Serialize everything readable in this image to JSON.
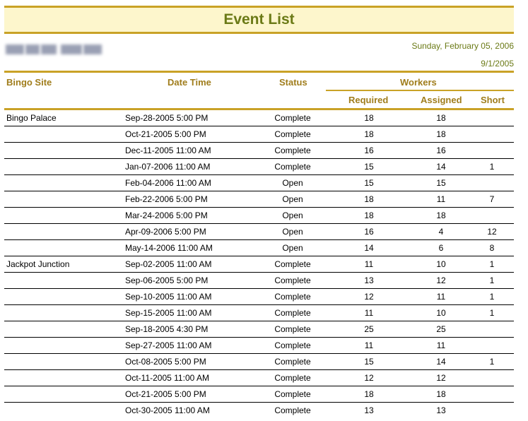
{
  "report": {
    "title": "Event List",
    "date": "Sunday, February 05, 2006",
    "sub_date": "9/1/2005"
  },
  "columns": {
    "site": "Bingo Site",
    "datetime": "Date Time",
    "status": "Status",
    "workers": "Workers",
    "required": "Required",
    "assigned": "Assigned",
    "short": "Short"
  },
  "rows": [
    {
      "site": "Bingo Palace",
      "datetime": "Sep-28-2005 5:00 PM",
      "status": "Complete",
      "required": "18",
      "assigned": "18",
      "short": ""
    },
    {
      "site": "",
      "datetime": "Oct-21-2005 5:00 PM",
      "status": "Complete",
      "required": "18",
      "assigned": "18",
      "short": ""
    },
    {
      "site": "",
      "datetime": "Dec-11-2005 11:00 AM",
      "status": "Complete",
      "required": "16",
      "assigned": "16",
      "short": ""
    },
    {
      "site": "",
      "datetime": "Jan-07-2006 11:00 AM",
      "status": "Complete",
      "required": "15",
      "assigned": "14",
      "short": "1"
    },
    {
      "site": "",
      "datetime": "Feb-04-2006 11:00 AM",
      "status": "Open",
      "required": "15",
      "assigned": "15",
      "short": ""
    },
    {
      "site": "",
      "datetime": "Feb-22-2006 5:00 PM",
      "status": "Open",
      "required": "18",
      "assigned": "11",
      "short": "7"
    },
    {
      "site": "",
      "datetime": "Mar-24-2006 5:00 PM",
      "status": "Open",
      "required": "18",
      "assigned": "18",
      "short": ""
    },
    {
      "site": "",
      "datetime": "Apr-09-2006 5:00 PM",
      "status": "Open",
      "required": "16",
      "assigned": "4",
      "short": "12"
    },
    {
      "site": "",
      "datetime": "May-14-2006 11:00 AM",
      "status": "Open",
      "required": "14",
      "assigned": "6",
      "short": "8"
    },
    {
      "site": "Jackpot Junction",
      "datetime": "Sep-02-2005 11:00 AM",
      "status": "Complete",
      "required": "11",
      "assigned": "10",
      "short": "1"
    },
    {
      "site": "",
      "datetime": "Sep-06-2005 5:00 PM",
      "status": "Complete",
      "required": "13",
      "assigned": "12",
      "short": "1"
    },
    {
      "site": "",
      "datetime": "Sep-10-2005 11:00 AM",
      "status": "Complete",
      "required": "12",
      "assigned": "11",
      "short": "1"
    },
    {
      "site": "",
      "datetime": "Sep-15-2005 11:00 AM",
      "status": "Complete",
      "required": "11",
      "assigned": "10",
      "short": "1"
    },
    {
      "site": "",
      "datetime": "Sep-18-2005 4:30 PM",
      "status": "Complete",
      "required": "25",
      "assigned": "25",
      "short": ""
    },
    {
      "site": "",
      "datetime": "Sep-27-2005 11:00 AM",
      "status": "Complete",
      "required": "11",
      "assigned": "11",
      "short": ""
    },
    {
      "site": "",
      "datetime": "Oct-08-2005 5:00 PM",
      "status": "Complete",
      "required": "15",
      "assigned": "14",
      "short": "1"
    },
    {
      "site": "",
      "datetime": "Oct-11-2005 11:00 AM",
      "status": "Complete",
      "required": "12",
      "assigned": "12",
      "short": ""
    },
    {
      "site": "",
      "datetime": "Oct-21-2005 5:00 PM",
      "status": "Complete",
      "required": "18",
      "assigned": "18",
      "short": ""
    },
    {
      "site": "",
      "datetime": "Oct-30-2005 11:00 AM",
      "status": "Complete",
      "required": "13",
      "assigned": "13",
      "short": ""
    }
  ]
}
